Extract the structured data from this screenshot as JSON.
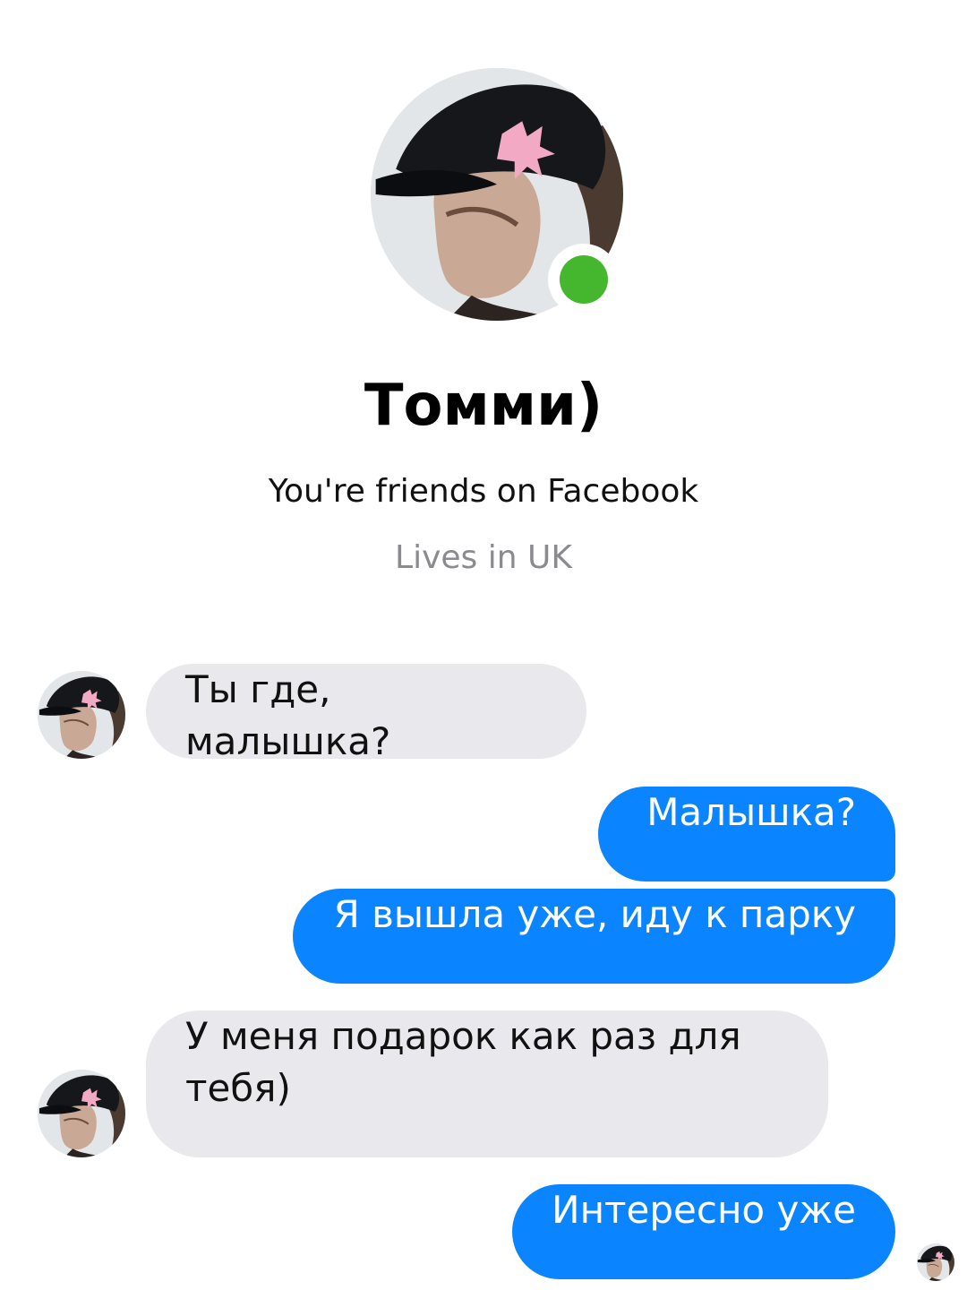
{
  "contact": {
    "name": "Томми)",
    "friends_status": "You're friends on Facebook",
    "location": "Lives in UK",
    "online": true,
    "online_color": "#44b72f"
  },
  "messages": [
    {
      "direction": "incoming",
      "text": "Ты где, малышка?"
    },
    {
      "direction": "outgoing",
      "text": "Малышка?"
    },
    {
      "direction": "outgoing",
      "text": "Я вышла уже, иду к парку"
    },
    {
      "direction": "incoming",
      "text": "У меня подарок как раз для тебя)"
    },
    {
      "direction": "outgoing",
      "text": "Интересно уже"
    }
  ],
  "theme": {
    "outgoing_bubble": "#0a84ff",
    "incoming_bubble": "#e9e8ed"
  }
}
